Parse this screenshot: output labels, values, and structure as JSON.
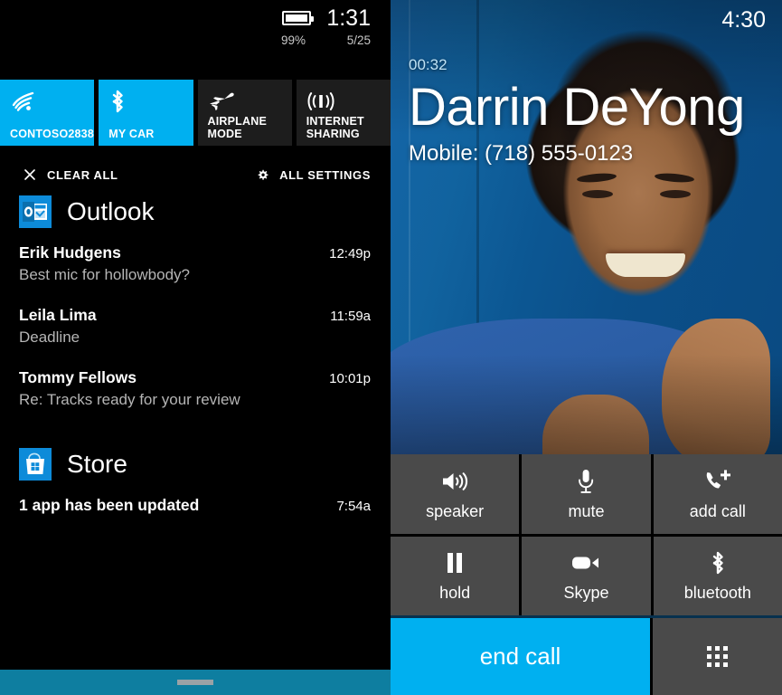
{
  "left_panel": {
    "status_bar": {
      "battery_icon": "battery-icon",
      "clock": "1:31",
      "battery_percent": "99%",
      "date": "5/25"
    },
    "quick_actions": [
      {
        "label": "CONTOSO2838",
        "icon": "wifi-icon",
        "state": "on"
      },
      {
        "label": "MY CAR",
        "icon": "bluetooth-icon",
        "state": "on"
      },
      {
        "label": "AIRPLANE MODE",
        "icon": "airplane-icon",
        "state": "off"
      },
      {
        "label": "INTERNET SHARING",
        "icon": "internet-sharing-icon",
        "state": "off"
      }
    ],
    "actions": {
      "clear_all": "CLEAR ALL",
      "clear_all_icon": "close-icon",
      "all_settings": "ALL SETTINGS",
      "all_settings_icon": "gear-icon"
    },
    "groups": [
      {
        "app": "Outlook",
        "app_icon": "outlook-icon",
        "items": [
          {
            "title": "Erik Hudgens",
            "body": "Best mic for hollowbody?",
            "time": "12:49p"
          },
          {
            "title": "Leila Lima",
            "body": "Deadline",
            "time": "11:59a"
          },
          {
            "title": "Tommy Fellows",
            "body": "Re: Tracks ready for your review",
            "time": "10:01p"
          }
        ]
      },
      {
        "app": "Store",
        "app_icon": "store-icon",
        "items": [
          {
            "title": "1 app has been updated",
            "body": "",
            "time": "7:54a"
          }
        ]
      }
    ],
    "nav_bar": {
      "handle": "nav-handle"
    },
    "colors": {
      "tile_on": "#00b0f0",
      "tile_off": "#1d1d1d",
      "nav_bar": "#0e7ea0",
      "background": "#000000"
    }
  },
  "right_panel": {
    "status_bar": {
      "clock": "4:30"
    },
    "call": {
      "timer": "00:32",
      "name": "Darrin DeYong",
      "number": "Mobile: (718) 555-0123"
    },
    "controls": [
      {
        "label": "speaker",
        "icon": "speaker-icon"
      },
      {
        "label": "mute",
        "icon": "microphone-icon"
      },
      {
        "label": "add call",
        "icon": "add-call-icon"
      },
      {
        "label": "hold",
        "icon": "pause-icon"
      },
      {
        "label": "Skype",
        "icon": "video-camera-icon"
      },
      {
        "label": "bluetooth",
        "icon": "bluetooth-icon"
      }
    ],
    "end_call": {
      "label": "end call"
    },
    "keypad": {
      "icon": "keypad-icon"
    },
    "colors": {
      "end_call": "#00b0f0",
      "button": "#4a4a4a",
      "accent_text": "#bfe2f5"
    }
  }
}
